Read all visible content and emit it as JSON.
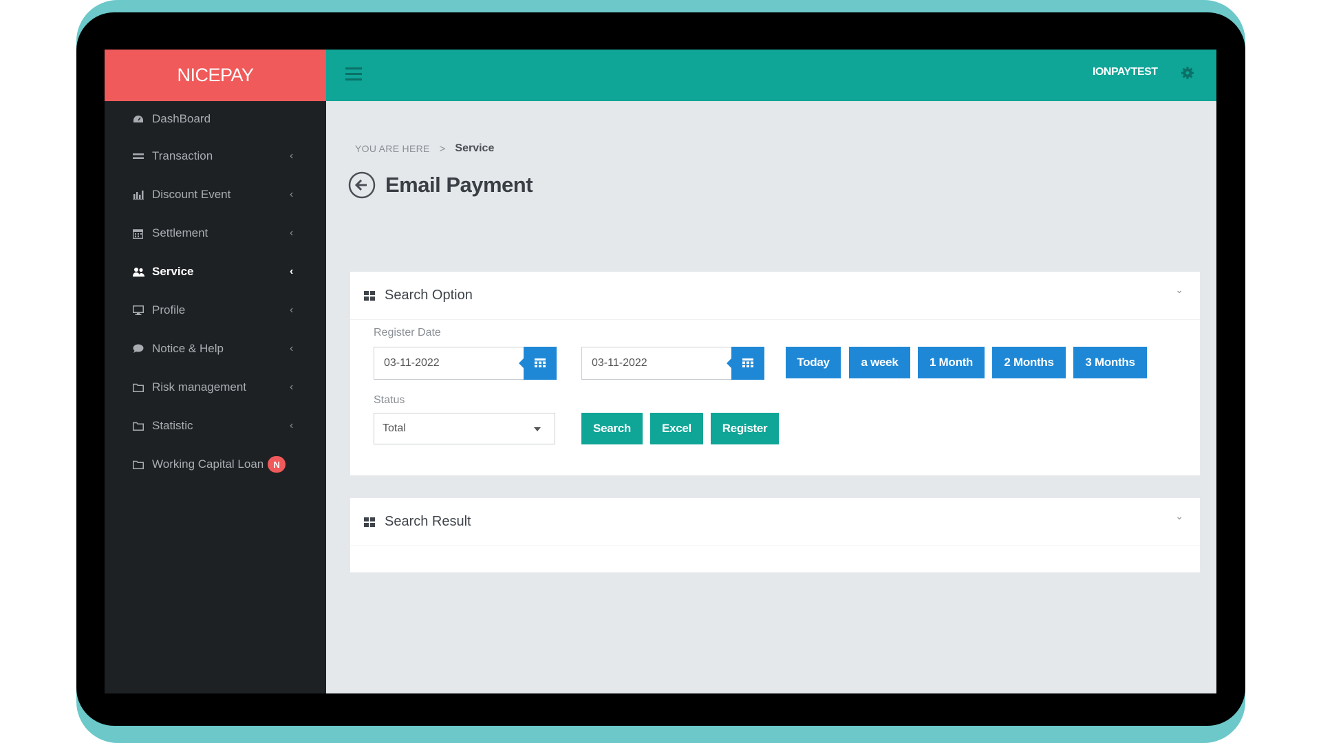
{
  "brand": "NICEPAY",
  "user": {
    "name": "IONPAYTEST"
  },
  "sidebar": {
    "items": [
      {
        "label": "DashBoard",
        "icon": "dashboard-icon"
      },
      {
        "label": "Transaction",
        "icon": "exchange-icon"
      },
      {
        "label": "Discount Event",
        "icon": "bar-chart-icon"
      },
      {
        "label": "Settlement",
        "icon": "calendar-icon"
      },
      {
        "label": "Service",
        "icon": "users-icon",
        "active": true
      },
      {
        "label": "Profile",
        "icon": "monitor-icon"
      },
      {
        "label": "Notice & Help",
        "icon": "comment-icon"
      },
      {
        "label": "Risk management",
        "icon": "folder-icon"
      },
      {
        "label": "Statistic",
        "icon": "folder-icon"
      },
      {
        "label": "Working Capital Loan",
        "icon": "folder-icon",
        "badge": "N"
      }
    ]
  },
  "breadcrumb": {
    "prefix": "YOU ARE HERE",
    "separator": ">",
    "current": "Service"
  },
  "page": {
    "title": "Email Payment"
  },
  "search_option": {
    "title": "Search Option",
    "register_date_label": "Register Date",
    "date_from": "03-11-2022",
    "date_to": "03-11-2022",
    "range_buttons": [
      "Today",
      "a week",
      "1 Month",
      "2 Months",
      "3 Months"
    ],
    "status_label": "Status",
    "status_value": "Total",
    "actions": {
      "search": "Search",
      "excel": "Excel",
      "register": "Register"
    }
  },
  "search_result": {
    "title": "Search Result"
  },
  "colors": {
    "brand": "#f05a5a",
    "topbar": "#0fa597",
    "sidebar": "#1e2124",
    "primary_blue": "#1e88d6",
    "frame": "#6cc8c9"
  }
}
